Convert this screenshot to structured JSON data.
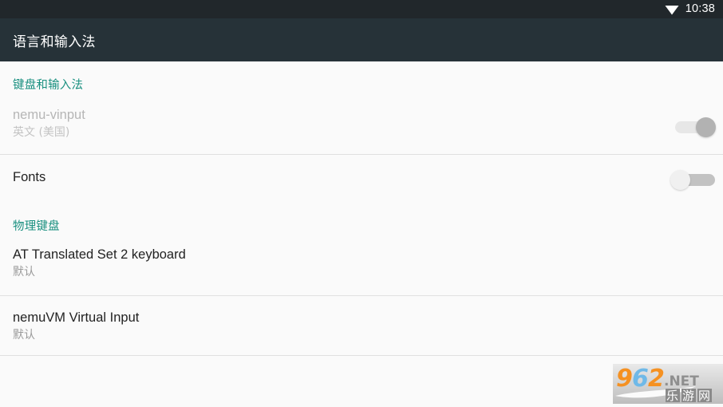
{
  "status_bar": {
    "wifi_icon": "wifi-icon",
    "time": "10:38",
    "background": "#21272b",
    "foreground": "#ffffff"
  },
  "action_bar": {
    "title": "语言和输入法",
    "background": "#263238",
    "foreground": "#ffffff"
  },
  "theme": {
    "accent": "#1a9080",
    "page_background": "#fafafa",
    "divider": "#e0e0e0",
    "text_primary": "#222222",
    "text_secondary": "#9a9a9a",
    "text_disabled": "#b6b6b6"
  },
  "sections": [
    {
      "header": "键盘和输入法",
      "rows": [
        {
          "title": "nemu-vinput",
          "subtitle": "英文 (美国)",
          "enabled": false,
          "switch": {
            "state": "on",
            "disabled": true
          }
        },
        {
          "title": "Fonts",
          "subtitle": "",
          "enabled": true,
          "switch": {
            "state": "off",
            "disabled": false
          }
        }
      ]
    },
    {
      "header": "物理键盘",
      "rows": [
        {
          "title": "AT Translated Set 2 keyboard",
          "subtitle": "默认",
          "enabled": true,
          "switch": null
        },
        {
          "title": "nemuVM Virtual Input",
          "subtitle": "默认",
          "enabled": true,
          "switch": null
        }
      ]
    }
  ],
  "watermark": {
    "digits": "962",
    "tld": ".NET",
    "chinese": "乐游网",
    "orange": "#f59122",
    "blue": "#6fb9e8",
    "gray": "#8d8d8d"
  }
}
